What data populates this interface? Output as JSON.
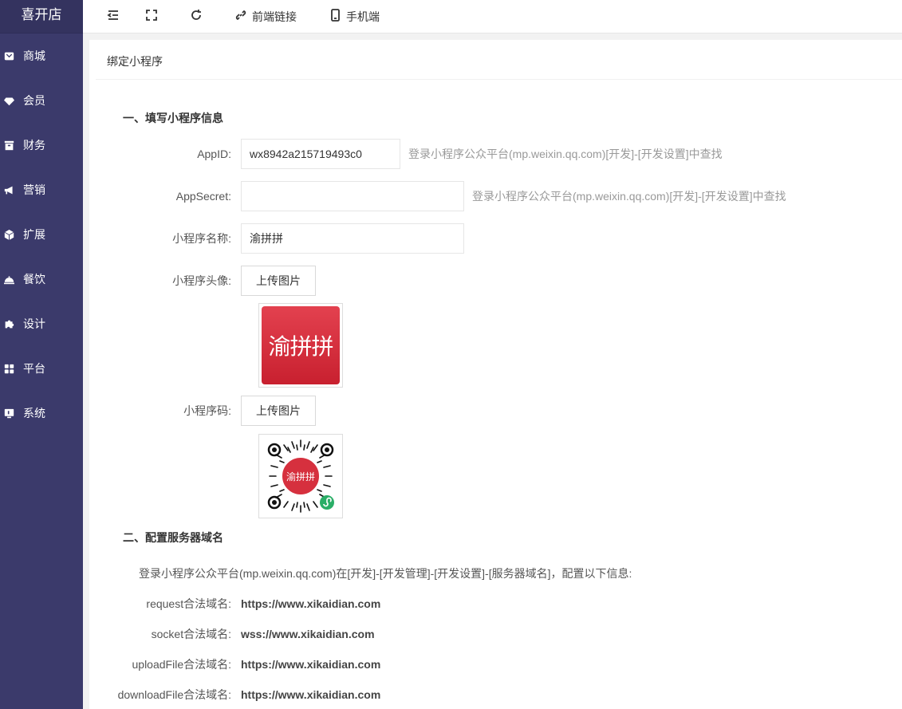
{
  "brand": "喜开店",
  "sidebar": {
    "items": [
      {
        "label": "商城",
        "icon": "shop-icon"
      },
      {
        "label": "会员",
        "icon": "diamond-icon"
      },
      {
        "label": "财务",
        "icon": "wallet-icon"
      },
      {
        "label": "营销",
        "icon": "megaphone-icon"
      },
      {
        "label": "扩展",
        "icon": "cube-icon"
      },
      {
        "label": "餐饮",
        "icon": "dish-icon"
      },
      {
        "label": "设计",
        "icon": "puzzle-icon"
      },
      {
        "label": "平台",
        "icon": "grid-icon"
      },
      {
        "label": "系统",
        "icon": "monitor-icon"
      }
    ]
  },
  "topbar": {
    "frontend_link": "前端链接",
    "mobile": "手机端"
  },
  "page": {
    "title": "绑定小程序"
  },
  "section1": {
    "title": "一、填写小程序信息",
    "appid_label": "AppID:",
    "appid_value": "wx8942a215719493c0",
    "appid_hint": "登录小程序公众平台(mp.weixin.qq.com)[开发]-[开发设置]中查找",
    "secret_label": "AppSecret:",
    "secret_value": "",
    "secret_hint": "登录小程序公众平台(mp.weixin.qq.com)[开发]-[开发设置]中查找",
    "name_label": "小程序名称:",
    "name_value": "渝拼拼",
    "avatar_label": "小程序头像:",
    "upload_label": "上传图片",
    "avatar_text": "渝拼拼",
    "qrcode_label": "小程序码:",
    "qrcode_text": "渝拼拼"
  },
  "section2": {
    "title": "二、配置服务器域名",
    "desc": "登录小程序公众平台(mp.weixin.qq.com)在[开发]-[开发管理]-[开发设置]-[服务器域名]，配置以下信息:",
    "domains": [
      {
        "label": "request合法域名:",
        "value": "https://www.xikaidian.com"
      },
      {
        "label": "socket合法域名:",
        "value": "wss://www.xikaidian.com"
      },
      {
        "label": "uploadFile合法域名:",
        "value": "https://www.xikaidian.com"
      },
      {
        "label": "downloadFile合法域名:",
        "value": "https://www.xikaidian.com"
      }
    ]
  },
  "colors": {
    "sidebar": "#3b3a6b",
    "accent_red": "#d6303e",
    "wechat_green": "#2aae67"
  }
}
